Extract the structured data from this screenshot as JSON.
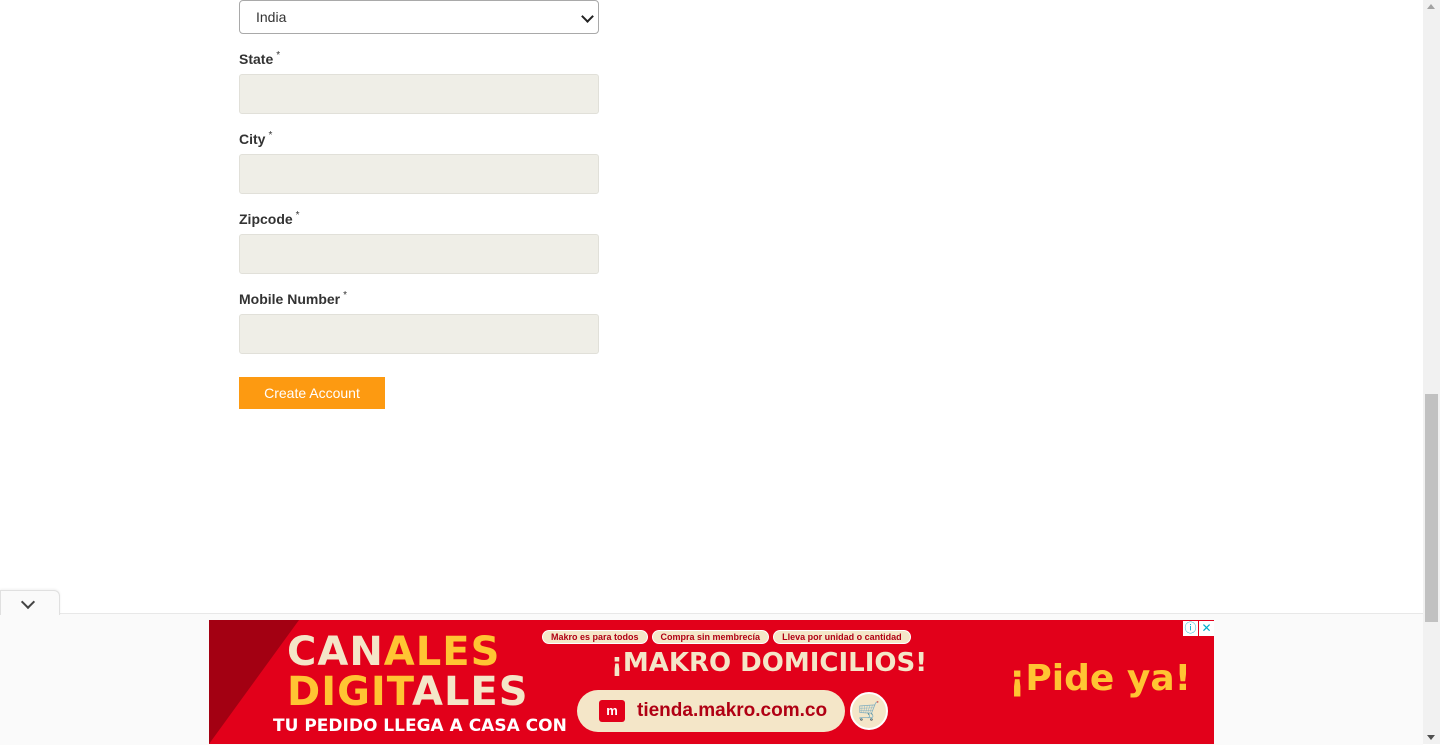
{
  "form": {
    "country": {
      "selected": "India"
    },
    "fields": [
      {
        "label": "State",
        "required_mark": "*",
        "value": ""
      },
      {
        "label": "City",
        "required_mark": "*",
        "value": ""
      },
      {
        "label": "Zipcode",
        "required_mark": "*",
        "value": ""
      },
      {
        "label": "Mobile Number",
        "required_mark": "*",
        "value": ""
      }
    ],
    "submit_label": "Create Account"
  },
  "ad": {
    "line1_a": "CAN",
    "line1_b": "ALES",
    "line2_a": "DIGIT",
    "line2_b": "ALES",
    "tagline": "TU PEDIDO LLEGA A CASA CON",
    "pills": [
      "Makro es para todos",
      "Compra sin membrecía",
      "Lleva por unidad o cantidad"
    ],
    "headline": "¡MAKRO DOMICILIOS!",
    "url": "tienda.makro.com.co",
    "cta": "¡Pide ya!",
    "info_glyph": "ⓘ",
    "close_glyph": "✕",
    "colors": {
      "background": "#e2001a",
      "accent": "#ffc433",
      "cream": "#f4e6c8"
    }
  },
  "icons": {
    "select_chevron": "chevron-down-icon",
    "collapse": "chevron-down-icon",
    "cart": "cart-icon",
    "store": "store-icon"
  },
  "colors": {
    "button": "#fd9a11",
    "input_bg": "#efeee7"
  }
}
